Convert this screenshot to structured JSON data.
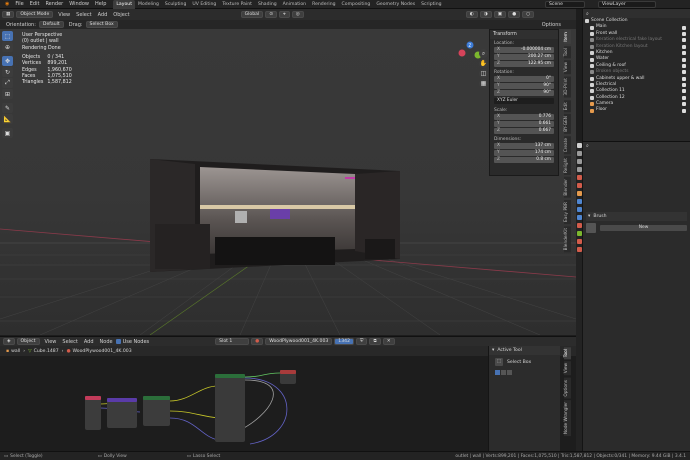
{
  "topbar": {
    "menus": [
      "File",
      "Edit",
      "Render",
      "Window",
      "Help"
    ],
    "workspaces": [
      "Layout",
      "Modeling",
      "Sculpting",
      "UV Editing",
      "Texture Paint",
      "Shading",
      "Animation",
      "Rendering",
      "Compositing",
      "Geometry Nodes",
      "Scripting"
    ],
    "active_workspace": "Layout",
    "scene": "Scene",
    "view_layer": "ViewLayer"
  },
  "viewport_header": {
    "mode": "Object Mode",
    "menus": [
      "View",
      "Select",
      "Add",
      "Object"
    ],
    "transform_orientation": "Global",
    "orientation_label": "Orientation:",
    "orientation_value": "Default",
    "drag_label": "Drag:",
    "drag_value": "Select Box",
    "options": "Options"
  },
  "overlay_stats": {
    "view": "User Perspective",
    "collection": "(0) outlet | wall",
    "status": "Rendering Done",
    "rows": [
      {
        "k": "Objects",
        "v": "0 / 341"
      },
      {
        "k": "Vertices",
        "v": "899,201"
      },
      {
        "k": "Edges",
        "v": "1,960,670"
      },
      {
        "k": "Faces",
        "v": "1,075,510"
      },
      {
        "k": "Triangles",
        "v": "1,587,812"
      }
    ]
  },
  "npanel": {
    "title": "Transform",
    "location_label": "Location:",
    "location": [
      {
        "k": "X",
        "v": "-0.000004 cm"
      },
      {
        "k": "Y",
        "v": "200.27 cm"
      },
      {
        "k": "Z",
        "v": "122.95 cm"
      }
    ],
    "rotation_label": "Rotation:",
    "rotation": [
      {
        "k": "X",
        "v": "0°"
      },
      {
        "k": "Y",
        "v": "90°"
      },
      {
        "k": "Z",
        "v": "90°"
      }
    ],
    "rotation_mode": "XYZ Euler",
    "scale_label": "Scale:",
    "scale": [
      {
        "k": "X",
        "v": "0.776"
      },
      {
        "k": "Y",
        "v": "0.661"
      },
      {
        "k": "Z",
        "v": "0.667"
      }
    ],
    "dimensions_label": "Dimensions:",
    "dimensions": [
      {
        "k": "X",
        "v": "137 cm"
      },
      {
        "k": "Y",
        "v": "174 cm"
      },
      {
        "k": "Z",
        "v": "0.8 cm"
      }
    ],
    "tabs": [
      "Item",
      "Tool",
      "View",
      "3D-Print",
      "Edit",
      "BY-GEN",
      "Create",
      "Relight",
      "Blender",
      "Easy PBR",
      "BlenderKit"
    ]
  },
  "outliner": {
    "title": "Scene Collection",
    "items": [
      {
        "label": "Main",
        "grey": false,
        "color": "#d2d2d2"
      },
      {
        "label": "Front wall",
        "grey": false,
        "color": "#d2d2d2"
      },
      {
        "label": "Iteration electrical fake layout",
        "grey": true,
        "color": "#888888"
      },
      {
        "label": "Iteration Kitchen layout",
        "grey": true,
        "color": "#888888"
      },
      {
        "label": "Kitchen",
        "grey": false,
        "color": "#d2d2d2"
      },
      {
        "label": "Water",
        "grey": false,
        "color": "#d2d2d2"
      },
      {
        "label": "Ceiling & roof",
        "grey": false,
        "color": "#d2d2d2"
      },
      {
        "label": "Broken objects",
        "grey": true,
        "color": "#888888"
      },
      {
        "label": "Cabinets upper & wall",
        "grey": false,
        "color": "#d2d2d2"
      },
      {
        "label": "Electrical",
        "grey": false,
        "color": "#d2d2d2"
      },
      {
        "label": "Collection 11",
        "grey": false,
        "color": "#d2d2d2"
      },
      {
        "label": "Collection 12",
        "grey": false,
        "color": "#d2d2d2"
      },
      {
        "label": "Camera",
        "grey": false,
        "color": "#e59a4d"
      },
      {
        "label": "Floor",
        "grey": false,
        "color": "#e59a4d"
      }
    ]
  },
  "properties": {
    "brush_label": "Brush",
    "new_button": "New"
  },
  "node_header": {
    "object_dd": "Object",
    "menus": [
      "View",
      "Select",
      "Add",
      "Node"
    ],
    "use_nodes": "Use Nodes",
    "slot": "Slot 1",
    "material": "WoodPlywood001_4K.003",
    "user_count": "1342"
  },
  "node_breadcrumb": {
    "items": [
      "wall",
      "Cube.1487",
      "WoodPlywood001_4K.003"
    ]
  },
  "active_tool": {
    "title": "Active Tool",
    "tool": "Select Box",
    "tabs": [
      "Tool",
      "View",
      "Options",
      "Node Wrangler"
    ]
  },
  "statusbar": {
    "left": "Select (Toggle)",
    "mid1": "Dolly View",
    "mid2": "Lasso Select",
    "right": "outlet | wall | Verts:899,201 | Faces:1,075,510 | Tris:1,587,812 | Objects:0/341 | Memory: 9.44 GiB | 3.4.1"
  }
}
